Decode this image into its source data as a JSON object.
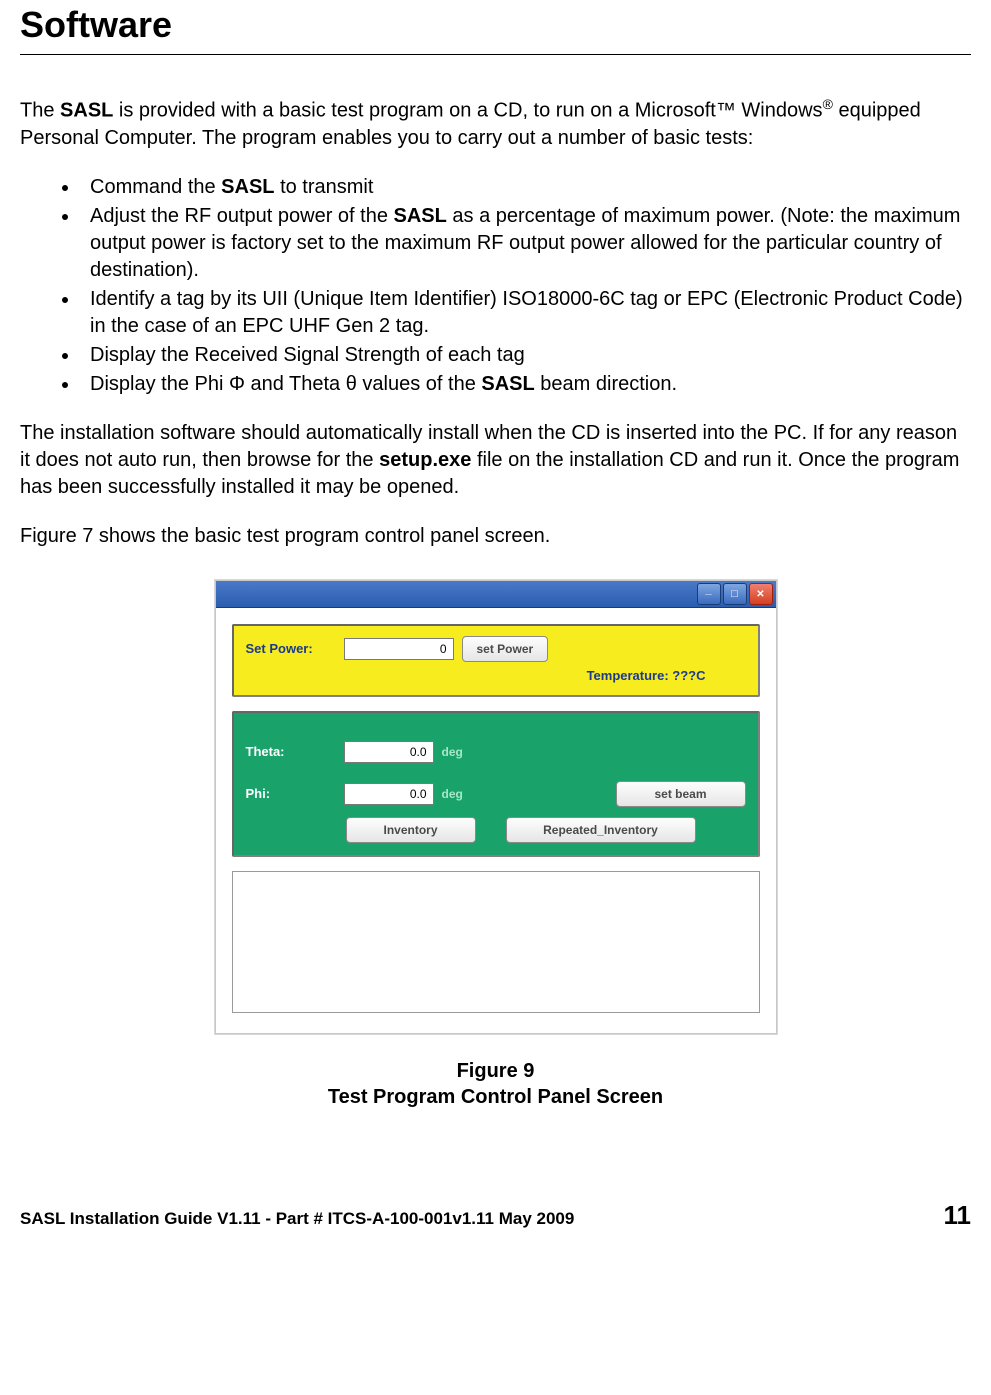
{
  "header": {
    "title": "Software"
  },
  "intro": {
    "p1_a": "The ",
    "p1_b": "SASL",
    "p1_c": " is provided with a basic test program on a CD, to run on a Microsoft™ Windows",
    "p1_sup": "®",
    "p1_d": " equipped Personal Computer. The program enables you to carry out a number of basic tests:"
  },
  "bullets": {
    "b1_a": "Command the ",
    "b1_b": "SASL",
    "b1_c": " to transmit",
    "b2_a": "Adjust the RF output power of the ",
    "b2_b": "SASL",
    "b2_c": " as a percentage of maximum power. (Note: the maximum output power is factory set to the maximum RF output power allowed for the particular country of destination).",
    "b3": "Identify a tag by its UII (Unique Item Identifier) ISO18000-6C tag or EPC (Electronic Product Code) in the case of an EPC UHF Gen 2 tag.",
    "b4": "Display the Received Signal Strength of each tag",
    "b5_a": "Display the Phi Φ and Theta θ values of the ",
    "b5_b": "SASL",
    "b5_c": " beam direction."
  },
  "para2_a": "The installation software should automatically install when the CD is inserted into the PC. If for any reason it does not auto run, then browse for the ",
  "para2_b": "setup.exe",
  "para2_c": " file on the installation CD and run it. Once the program has been successfully installed it may be opened.",
  "para3": "Figure 7 shows the basic test program control panel screen.",
  "app": {
    "set_power_label": "Set Power:",
    "set_power_value": "0",
    "set_power_button": "set Power",
    "temperature": "Temperature: ???C",
    "theta_label": "Theta:",
    "theta_value": "0.0",
    "phi_label": "Phi:",
    "phi_value": "0.0",
    "deg": "deg",
    "set_beam_button": "set beam",
    "inventory_button": "Inventory",
    "repeated_inventory_button": "Repeated_Inventory"
  },
  "caption": {
    "line1": "Figure 9",
    "line2": "Test Program Control Panel Screen"
  },
  "footer": {
    "left": "SASL Installation Guide V1.11 - Part # ITCS-A-100-001v1.11 May 2009",
    "page": "11"
  }
}
